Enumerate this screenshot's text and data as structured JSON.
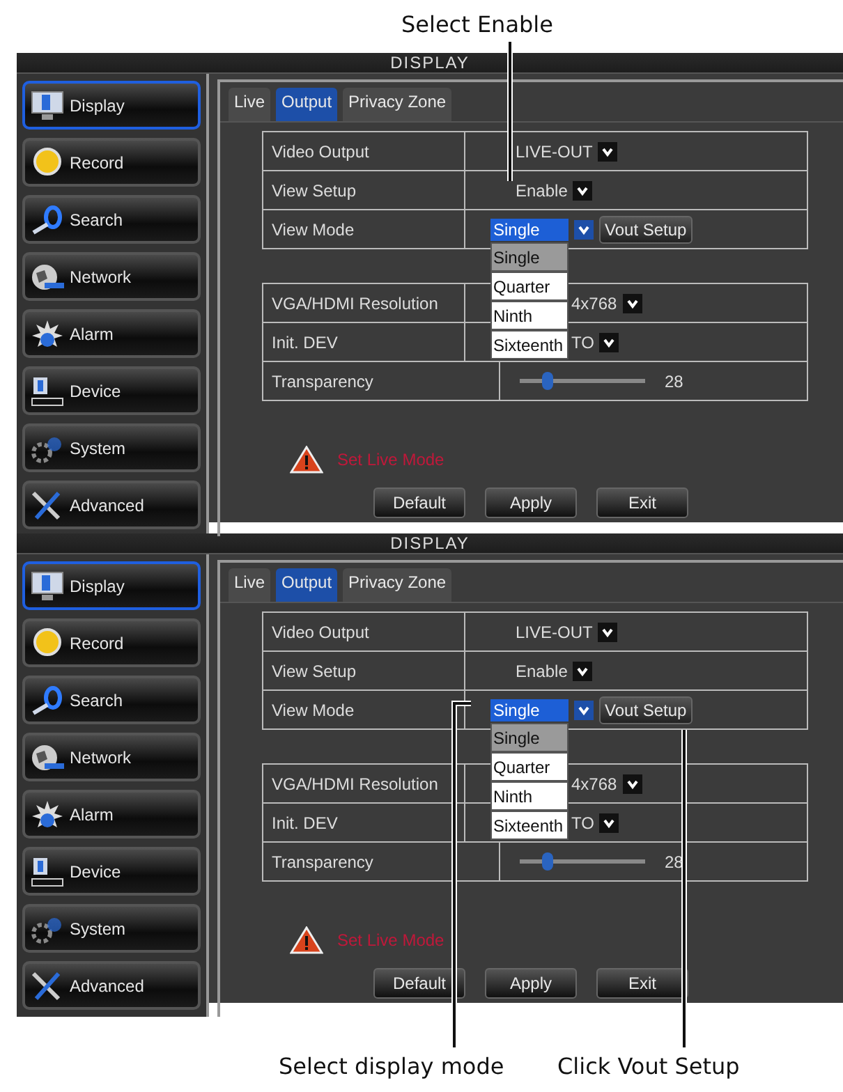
{
  "top_callout": "Select Enable",
  "screens": [
    {
      "title": "DISPLAY",
      "sidebar": [
        {
          "label": "Display",
          "selected": true
        },
        {
          "label": "Record",
          "selected": false
        },
        {
          "label": "Search",
          "selected": false
        },
        {
          "label": "Network",
          "selected": false
        },
        {
          "label": "Alarm",
          "selected": false
        },
        {
          "label": "Device",
          "selected": false
        },
        {
          "label": "System",
          "selected": false
        },
        {
          "label": "Advanced",
          "selected": false
        }
      ],
      "tabs": [
        {
          "label": "Live",
          "selected": false
        },
        {
          "label": "Output",
          "selected": true
        },
        {
          "label": "Privacy Zone",
          "selected": false
        }
      ],
      "settings": [
        {
          "label": "Video Output",
          "value": "LIVE-OUT"
        },
        {
          "label": "View Setup",
          "value": "Enable"
        },
        {
          "label": "View Mode",
          "value": "Single",
          "button": "Vout Setup",
          "options": [
            {
              "label": "Single",
              "selected": true
            },
            {
              "label": "Quarter",
              "selected": false
            },
            {
              "label": "Ninth",
              "selected": false
            },
            {
              "label": "Sixteenth",
              "selected": false
            }
          ]
        }
      ],
      "display": [
        {
          "kind": "select",
          "label": "VGA/HDMI Resolution",
          "value": "4x768"
        },
        {
          "kind": "select",
          "label": "Init. DEV",
          "value": "TO"
        },
        {
          "kind": "slider",
          "label": "Transparency",
          "level": 0.22,
          "reading": "28"
        }
      ],
      "warning": "Set Live Mode",
      "buttons": [
        "Default",
        "Apply",
        "Exit"
      ]
    },
    {
      "title": "DISPLAY",
      "sidebar": [
        {
          "label": "Display",
          "selected": true
        },
        {
          "label": "Record",
          "selected": false
        },
        {
          "label": "Search",
          "selected": false
        },
        {
          "label": "Network",
          "selected": false
        },
        {
          "label": "Alarm",
          "selected": false
        },
        {
          "label": "Device",
          "selected": false
        },
        {
          "label": "System",
          "selected": false
        },
        {
          "label": "Advanced",
          "selected": false
        }
      ],
      "tabs": [
        {
          "label": "Live",
          "selected": false
        },
        {
          "label": "Output",
          "selected": true
        },
        {
          "label": "Privacy Zone",
          "selected": false
        }
      ],
      "settings": [
        {
          "label": "Video Output",
          "value": "LIVE-OUT"
        },
        {
          "label": "View Setup",
          "value": "Enable"
        },
        {
          "label": "View Mode",
          "value": "Single",
          "button": "Vout Setup",
          "options": [
            {
              "label": "Single",
              "selected": true
            },
            {
              "label": "Quarter",
              "selected": false
            },
            {
              "label": "Ninth",
              "selected": false
            },
            {
              "label": "Sixteenth",
              "selected": false
            }
          ]
        }
      ],
      "display": [
        {
          "kind": "select",
          "label": "VGA/HDMI Resolution",
          "value": "4x768"
        },
        {
          "kind": "select",
          "label": "Init. DEV",
          "value": "TO"
        },
        {
          "kind": "slider",
          "label": "Transparency",
          "level": 0.22,
          "reading": "28"
        }
      ],
      "warning": "Set Live Mode",
      "buttons": [
        "Default",
        "Apply",
        "Exit"
      ]
    }
  ],
  "bottom_callouts": [
    "Select display mode",
    "Click Vout Setup"
  ]
}
